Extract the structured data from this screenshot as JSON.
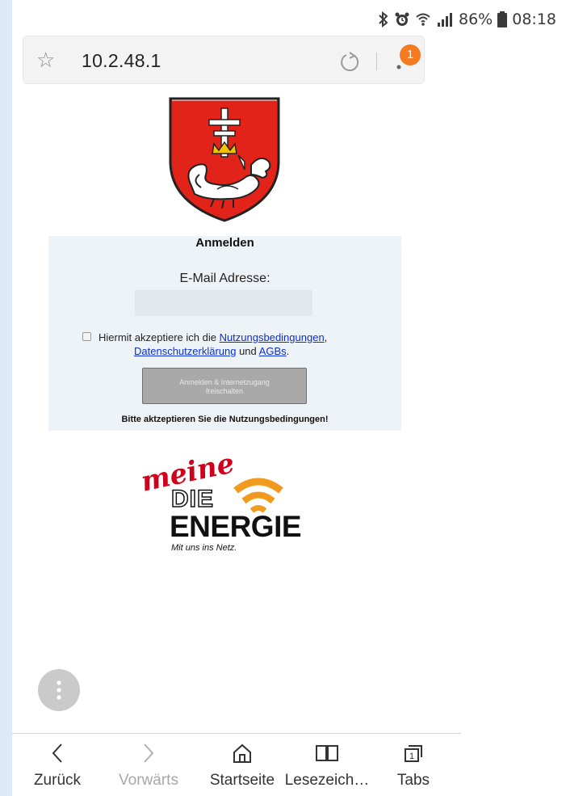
{
  "status_bar": {
    "battery": "86%",
    "time": "08:18"
  },
  "browser": {
    "url": "10.2.48.1",
    "notification_count": "1"
  },
  "login": {
    "title": "Anmelden",
    "email_label": "E-Mail Adresse:",
    "email_value": "",
    "terms_prefix": "Hiermit akzeptiere ich die ",
    "terms_link": "Nutzungsbedingungen",
    "terms_comma": ",",
    "privacy_link": "Datenschutzerklärung",
    "and_text": " und ",
    "agb_link": "AGBs",
    "period": ".",
    "submit_label_line1": "Anmelden & Internetzugang",
    "submit_label_line2": "freischalten",
    "warning": "Bitte aktzeptieren Sie die Nutzungsbedingungen!"
  },
  "logo": {
    "brand_top": "meine",
    "brand_mid": "DIE",
    "brand_main": "ENERGIE",
    "tagline": "Mit uns ins Netz."
  },
  "bottom_nav": [
    {
      "label": "Zurück",
      "icon": "back-icon",
      "enabled": true
    },
    {
      "label": "Vorwärts",
      "icon": "forward-icon",
      "enabled": false
    },
    {
      "label": "Startseite",
      "icon": "home-icon",
      "enabled": true
    },
    {
      "label": "Lesezeich…",
      "icon": "bookmarks-icon",
      "enabled": true
    },
    {
      "label": "Tabs",
      "icon": "tabs-icon",
      "enabled": true,
      "count": "1"
    }
  ],
  "colors": {
    "crest_red": "#e2231a",
    "brand_red": "#d0021b",
    "brand_orange": "#f29a1d",
    "badge": "#f47b1f"
  }
}
